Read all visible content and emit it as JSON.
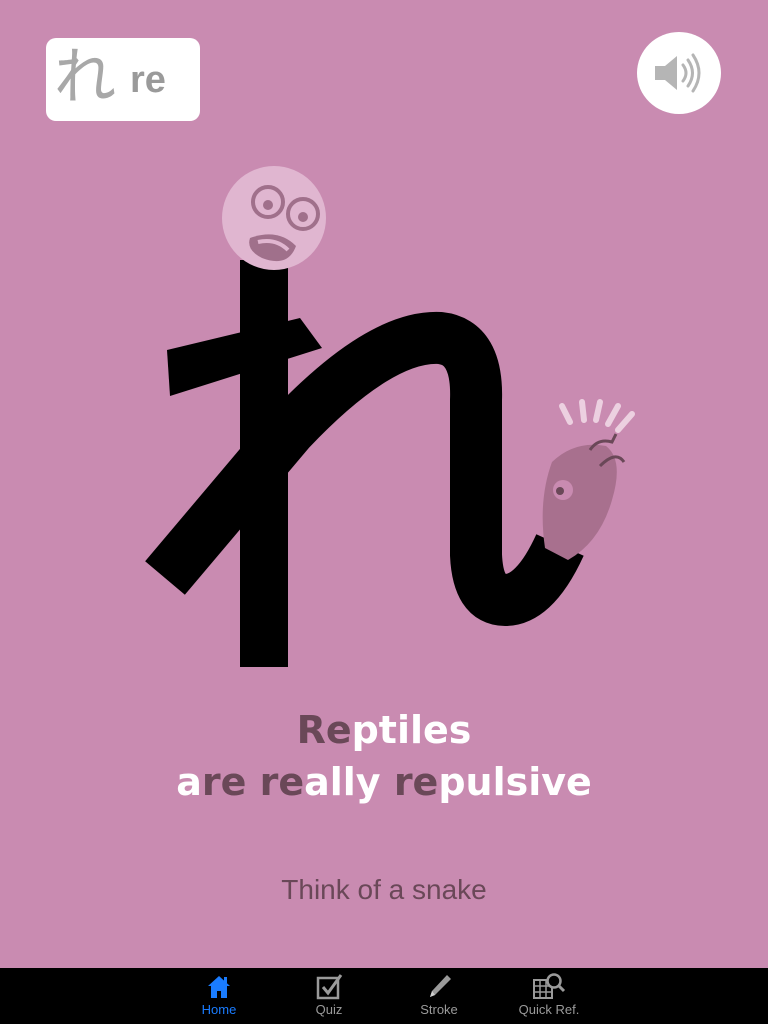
{
  "card": {
    "kana": "れ",
    "romaji": "re"
  },
  "sound_button": {
    "icon": "speaker-icon"
  },
  "illustration": {
    "subject": "snake",
    "icons": [
      "scared-face-icon",
      "snake-head-icon"
    ],
    "stroke_color": "#000000",
    "face_color": "#e0b6d0",
    "snake_head_color": "#a8708e"
  },
  "mnemonic": {
    "line1": [
      {
        "text": "Re",
        "highlight": true
      },
      {
        "text": "ptiles",
        "highlight": false
      }
    ],
    "line2": [
      {
        "text": "a",
        "highlight": false
      },
      {
        "text": "re",
        "highlight": true
      },
      {
        "text": " ",
        "highlight": false
      },
      {
        "text": "re",
        "highlight": true
      },
      {
        "text": "ally ",
        "highlight": false
      },
      {
        "text": "re",
        "highlight": true
      },
      {
        "text": "pulsive",
        "highlight": false
      }
    ]
  },
  "hint": "Think of a snake",
  "tabbar": {
    "tabs": [
      {
        "label": "Home",
        "icon": "home-icon",
        "active": true
      },
      {
        "label": "Quiz",
        "icon": "checkbox-icon",
        "active": false
      },
      {
        "label": "Stroke",
        "icon": "pencil-icon",
        "active": false
      },
      {
        "label": "Quick Ref.",
        "icon": "grid-search-icon",
        "active": false
      }
    ]
  },
  "colors": {
    "background": "#c98bb1",
    "highlight_text": "#6a4858",
    "active_tab": "#1a7cff",
    "inactive_tab": "#9a9a9a"
  }
}
